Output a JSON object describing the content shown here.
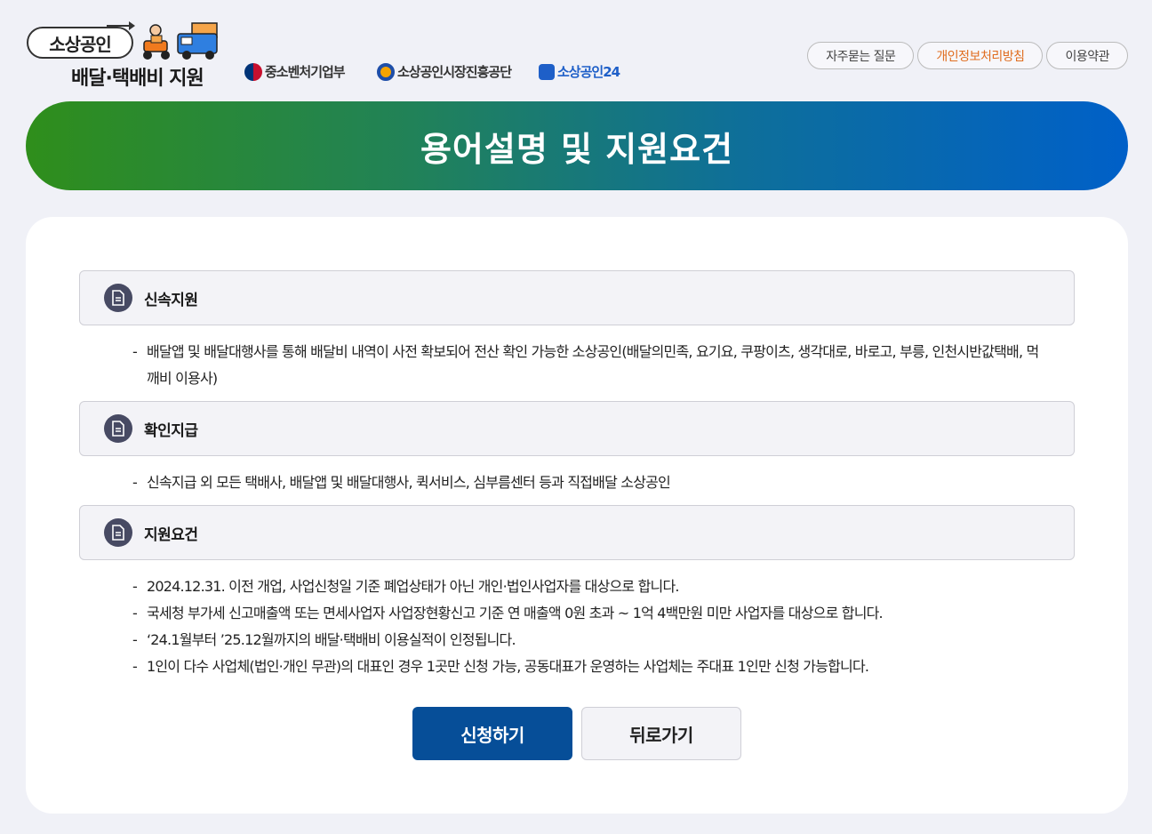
{
  "header": {
    "logo_top": "소상공인",
    "logo_bottom": "배달·택배비 지원",
    "orgs": [
      "중소벤처기업부",
      "소상공인시장진흥공단",
      "소상공인24"
    ],
    "links": [
      {
        "label": "자주묻는 질문"
      },
      {
        "label": "개인정보처리방침"
      },
      {
        "label": "이용약관"
      }
    ]
  },
  "banner": {
    "title": "용어설명 및 지원요건"
  },
  "sections": [
    {
      "title": "신속지원",
      "items": [
        "배달앱 및 배달대행사를 통해 배달비 내역이 사전 확보되어 전산 확인 가능한 소상공인(배달의민족, 요기요, 쿠팡이츠, 생각대로, 바로고, 부릉, 인천시반값택배, 먹깨비 이용사)"
      ]
    },
    {
      "title": "확인지급",
      "items": [
        "신속지급 외 모든 택배사, 배달앱 및 배달대행사, 퀵서비스, 심부름센터 등과 직접배달 소상공인"
      ]
    },
    {
      "title": "지원요건",
      "items": [
        "2024.12.31. 이전 개업, 사업신청일 기준 폐업상태가 아닌 개인·법인사업자를 대상으로 합니다.",
        "국세청 부가세 신고매출액 또는 면세사업자 사업장현황신고 기준 연 매출액 0원 초과 ~ 1억 4백만원 미만 사업자를 대상으로 합니다.",
        "‘24.1월부터 ’25.12월까지의 배달·택배비 이용실적이 인정됩니다.",
        "1인이 다수 사업체(법인·개인 무관)의 대표인 경우 1곳만 신청 가능, 공동대표가 운영하는 사업체는 주대표 1인만 신청 가능합니다."
      ]
    }
  ],
  "buttons": {
    "apply": "신청하기",
    "back": "뒤로가기"
  },
  "colors": {
    "primary": "#064e98",
    "accent": "#e06d1f",
    "banner_start": "#2f8e1b",
    "banner_end": "#0060c8"
  }
}
